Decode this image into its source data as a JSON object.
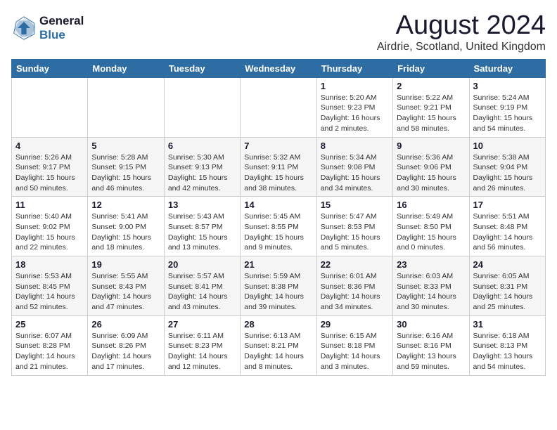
{
  "logo": {
    "line1": "General",
    "line2": "Blue"
  },
  "title": "August 2024",
  "subtitle": "Airdrie, Scotland, United Kingdom",
  "days_of_week": [
    "Sunday",
    "Monday",
    "Tuesday",
    "Wednesday",
    "Thursday",
    "Friday",
    "Saturday"
  ],
  "weeks": [
    [
      {
        "day": "",
        "info": ""
      },
      {
        "day": "",
        "info": ""
      },
      {
        "day": "",
        "info": ""
      },
      {
        "day": "",
        "info": ""
      },
      {
        "day": "1",
        "info": "Sunrise: 5:20 AM\nSunset: 9:23 PM\nDaylight: 16 hours\nand 2 minutes."
      },
      {
        "day": "2",
        "info": "Sunrise: 5:22 AM\nSunset: 9:21 PM\nDaylight: 15 hours\nand 58 minutes."
      },
      {
        "day": "3",
        "info": "Sunrise: 5:24 AM\nSunset: 9:19 PM\nDaylight: 15 hours\nand 54 minutes."
      }
    ],
    [
      {
        "day": "4",
        "info": "Sunrise: 5:26 AM\nSunset: 9:17 PM\nDaylight: 15 hours\nand 50 minutes."
      },
      {
        "day": "5",
        "info": "Sunrise: 5:28 AM\nSunset: 9:15 PM\nDaylight: 15 hours\nand 46 minutes."
      },
      {
        "day": "6",
        "info": "Sunrise: 5:30 AM\nSunset: 9:13 PM\nDaylight: 15 hours\nand 42 minutes."
      },
      {
        "day": "7",
        "info": "Sunrise: 5:32 AM\nSunset: 9:11 PM\nDaylight: 15 hours\nand 38 minutes."
      },
      {
        "day": "8",
        "info": "Sunrise: 5:34 AM\nSunset: 9:08 PM\nDaylight: 15 hours\nand 34 minutes."
      },
      {
        "day": "9",
        "info": "Sunrise: 5:36 AM\nSunset: 9:06 PM\nDaylight: 15 hours\nand 30 minutes."
      },
      {
        "day": "10",
        "info": "Sunrise: 5:38 AM\nSunset: 9:04 PM\nDaylight: 15 hours\nand 26 minutes."
      }
    ],
    [
      {
        "day": "11",
        "info": "Sunrise: 5:40 AM\nSunset: 9:02 PM\nDaylight: 15 hours\nand 22 minutes."
      },
      {
        "day": "12",
        "info": "Sunrise: 5:41 AM\nSunset: 9:00 PM\nDaylight: 15 hours\nand 18 minutes."
      },
      {
        "day": "13",
        "info": "Sunrise: 5:43 AM\nSunset: 8:57 PM\nDaylight: 15 hours\nand 13 minutes."
      },
      {
        "day": "14",
        "info": "Sunrise: 5:45 AM\nSunset: 8:55 PM\nDaylight: 15 hours\nand 9 minutes."
      },
      {
        "day": "15",
        "info": "Sunrise: 5:47 AM\nSunset: 8:53 PM\nDaylight: 15 hours\nand 5 minutes."
      },
      {
        "day": "16",
        "info": "Sunrise: 5:49 AM\nSunset: 8:50 PM\nDaylight: 15 hours\nand 0 minutes."
      },
      {
        "day": "17",
        "info": "Sunrise: 5:51 AM\nSunset: 8:48 PM\nDaylight: 14 hours\nand 56 minutes."
      }
    ],
    [
      {
        "day": "18",
        "info": "Sunrise: 5:53 AM\nSunset: 8:45 PM\nDaylight: 14 hours\nand 52 minutes."
      },
      {
        "day": "19",
        "info": "Sunrise: 5:55 AM\nSunset: 8:43 PM\nDaylight: 14 hours\nand 47 minutes."
      },
      {
        "day": "20",
        "info": "Sunrise: 5:57 AM\nSunset: 8:41 PM\nDaylight: 14 hours\nand 43 minutes."
      },
      {
        "day": "21",
        "info": "Sunrise: 5:59 AM\nSunset: 8:38 PM\nDaylight: 14 hours\nand 39 minutes."
      },
      {
        "day": "22",
        "info": "Sunrise: 6:01 AM\nSunset: 8:36 PM\nDaylight: 14 hours\nand 34 minutes."
      },
      {
        "day": "23",
        "info": "Sunrise: 6:03 AM\nSunset: 8:33 PM\nDaylight: 14 hours\nand 30 minutes."
      },
      {
        "day": "24",
        "info": "Sunrise: 6:05 AM\nSunset: 8:31 PM\nDaylight: 14 hours\nand 25 minutes."
      }
    ],
    [
      {
        "day": "25",
        "info": "Sunrise: 6:07 AM\nSunset: 8:28 PM\nDaylight: 14 hours\nand 21 minutes."
      },
      {
        "day": "26",
        "info": "Sunrise: 6:09 AM\nSunset: 8:26 PM\nDaylight: 14 hours\nand 17 minutes."
      },
      {
        "day": "27",
        "info": "Sunrise: 6:11 AM\nSunset: 8:23 PM\nDaylight: 14 hours\nand 12 minutes."
      },
      {
        "day": "28",
        "info": "Sunrise: 6:13 AM\nSunset: 8:21 PM\nDaylight: 14 hours\nand 8 minutes."
      },
      {
        "day": "29",
        "info": "Sunrise: 6:15 AM\nSunset: 8:18 PM\nDaylight: 14 hours\nand 3 minutes."
      },
      {
        "day": "30",
        "info": "Sunrise: 6:16 AM\nSunset: 8:16 PM\nDaylight: 13 hours\nand 59 minutes."
      },
      {
        "day": "31",
        "info": "Sunrise: 6:18 AM\nSunset: 8:13 PM\nDaylight: 13 hours\nand 54 minutes."
      }
    ]
  ]
}
